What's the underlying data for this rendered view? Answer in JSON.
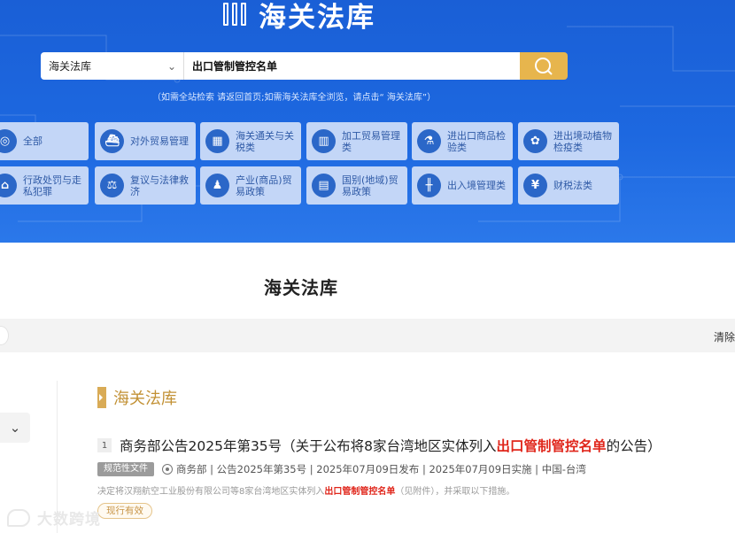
{
  "header": {
    "logo_text": "海关法库"
  },
  "search": {
    "scope_value": "海关法库",
    "query": "出口管制管控名单",
    "hint": "（如需全站检索 请返回首页;如需海关法库全浏览，请点击“ 海关法库”）"
  },
  "categories": [
    {
      "label": "全部",
      "icon": "globe-icon"
    },
    {
      "label": "对外贸易管理",
      "icon": "ship-icon"
    },
    {
      "label": "海关通关与关税类",
      "icon": "building-icon"
    },
    {
      "label": "加工贸易管理类",
      "icon": "factory-icon"
    },
    {
      "label": "进出口商品检验类",
      "icon": "inspection-icon"
    },
    {
      "label": "进出境动植物检疫类",
      "icon": "plant-quarantine-icon"
    },
    {
      "label": "行政处罚与走私犯罪",
      "icon": "court-icon"
    },
    {
      "label": "复议与法律救济",
      "icon": "scales-icon"
    },
    {
      "label": "产业(商品)贸易政策",
      "icon": "person-icon"
    },
    {
      "label": "国别(地域)贸易政策",
      "icon": "map-icon"
    },
    {
      "label": "出入境管理类",
      "icon": "road-icon"
    },
    {
      "label": "财税法类",
      "icon": "yen-icon"
    }
  ],
  "main": {
    "page_title": "海关法库",
    "clear_label": "清除",
    "section_title": "海关法库"
  },
  "result": {
    "index": "1",
    "title_prefix": "商务部公告2025年第35号（关于公布将8家台湾地区实体列入",
    "title_highlight": "出口管制管控名单",
    "title_suffix": "的公告）",
    "doc_type": "规范性文件",
    "meta": "商务部 | 公告2025年第35号 | 2025年07月09日发布 | 2025年07月09日实施 | 中国-台湾",
    "snippet_prefix": "决定将汉翔航空工业股份有限公司等8家台湾地区实体列入",
    "snippet_highlight": "出口管制管控名单",
    "snippet_suffix": "（见附件），并采取以下措施。",
    "status": "现行有效"
  },
  "watermark": {
    "text": "大数跨境"
  },
  "colors": {
    "banner_blue": "#1d68e0",
    "search_button": "#e7b54d",
    "category_bg": "#c3d6f7",
    "highlight_red": "#e0261b",
    "gold": "#c29135"
  }
}
